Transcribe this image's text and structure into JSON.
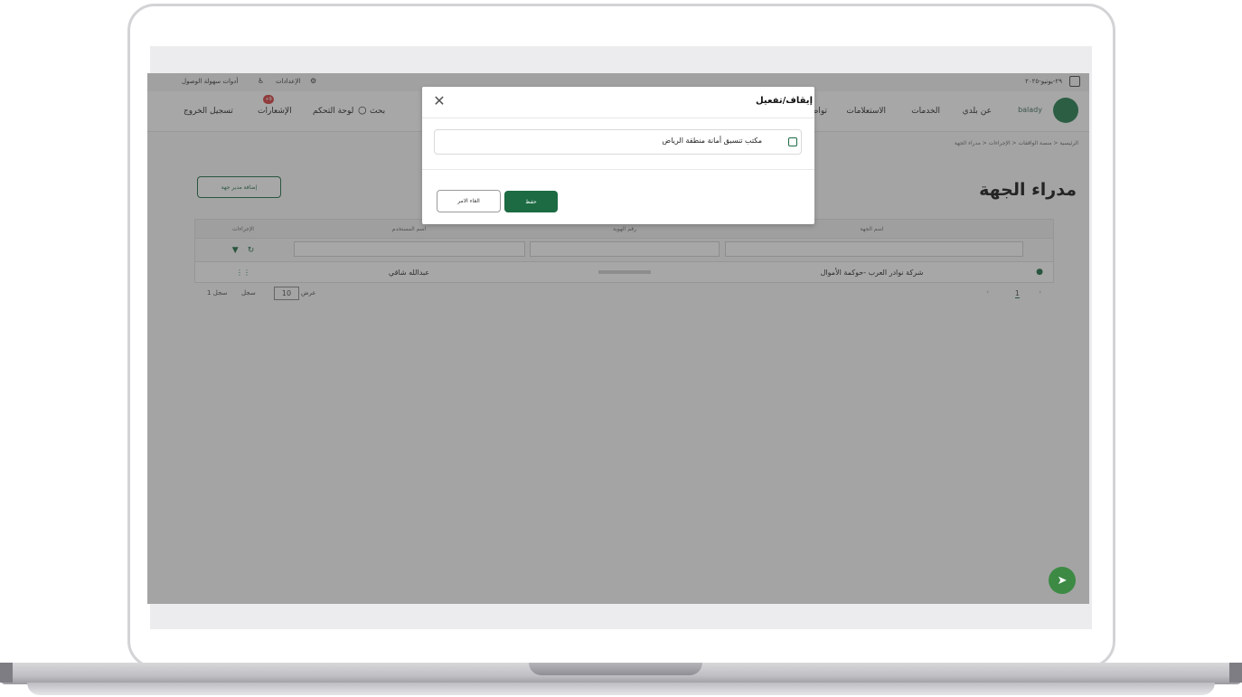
{
  "topbar": {
    "date": "٢٩-يونيو-٢٠٢٥",
    "accessibility": "أدوات سهولة الوصول",
    "settings": "الإعدادات"
  },
  "navbar": {
    "logout": "تسجيل الخروج",
    "notifications": "الإشعارات",
    "notifications_badge": "+9",
    "dashboard": "لوحة التحكم",
    "search": "بحث",
    "menu": [
      "عن بلدي",
      "الخدمات",
      "الاستعلامات",
      "تواصل"
    ],
    "logo_text": "balady"
  },
  "breadcrumbs": [
    "الرئيسية",
    "منصة الواقفات",
    "الإجراءات",
    "مدراء الجهة"
  ],
  "page": {
    "title": "مدراء الجهة",
    "add_button": "إضافة مدير جهة"
  },
  "table": {
    "headers": [
      "الإجراءات",
      "اسم المستخدم",
      "رقم الهوية",
      "اسم الجهة"
    ],
    "rows": [
      {
        "actions": "⋮⋮",
        "username": "عبدالله شاقي",
        "id_number": "",
        "entity": "شركة نوادر العرب -حوكمة الأموال"
      }
    ]
  },
  "pagination": {
    "show_label": "عرض",
    "page_size": "10",
    "per_label": "سجل",
    "total": "1 سجل",
    "current_page": "1"
  },
  "modal": {
    "title": "إيقاف/تفعيل",
    "item_label": "مكتب تنسيق أمانة منطقة الرياض",
    "save": "حفظ",
    "cancel": "الغاء الامر"
  },
  "colors": {
    "brand_green": "#1c6b43",
    "fab_green": "#3d8a45"
  }
}
